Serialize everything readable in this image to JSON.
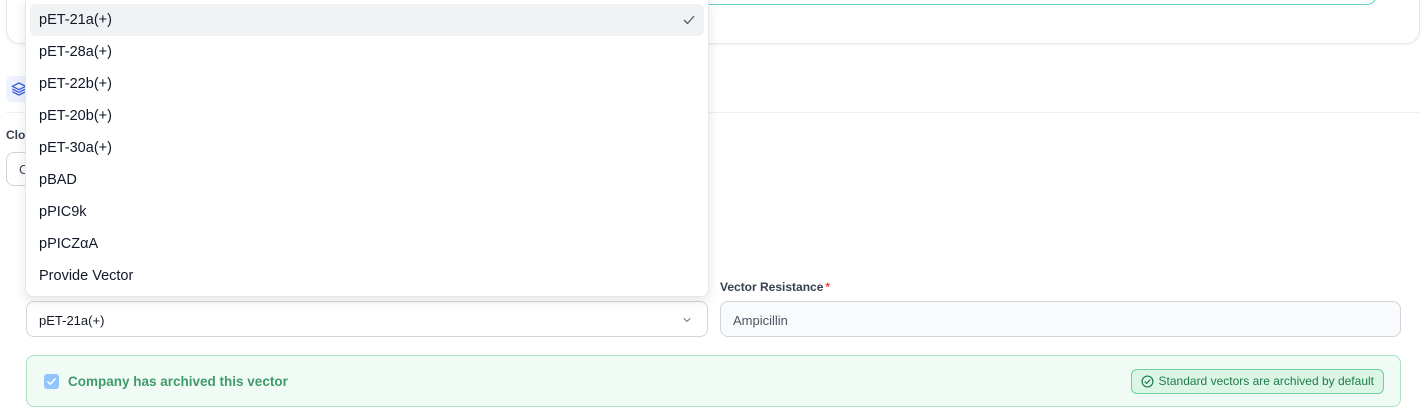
{
  "clone": {
    "label": "Clo",
    "value": "C"
  },
  "dropdown": {
    "options": [
      "pET-21a(+)",
      "pET-28a(+)",
      "pET-22b(+)",
      "pET-20b(+)",
      "pET-30a(+)",
      "pBAD",
      "pPIC9k",
      "pPICZαA",
      "Provide Vector"
    ],
    "selected_index": 0
  },
  "vector": {
    "selected_value": "pET-21a(+)"
  },
  "resistance": {
    "label": "Vector Resistance",
    "required_mark": "*",
    "value": "Ampicillin"
  },
  "archive": {
    "checkbox_label": "Company has archived this vector",
    "checked": true,
    "badge": "Standard vectors are archived by default"
  },
  "icons": [
    "layers-icon",
    "check-icon",
    "chevron-down-icon",
    "check-circle-icon"
  ],
  "colors": {
    "accent_teal": "#5fd3c8",
    "archive_bg": "#f0fbf5",
    "archive_text": "#3f9a6c",
    "required": "#ef4444"
  }
}
